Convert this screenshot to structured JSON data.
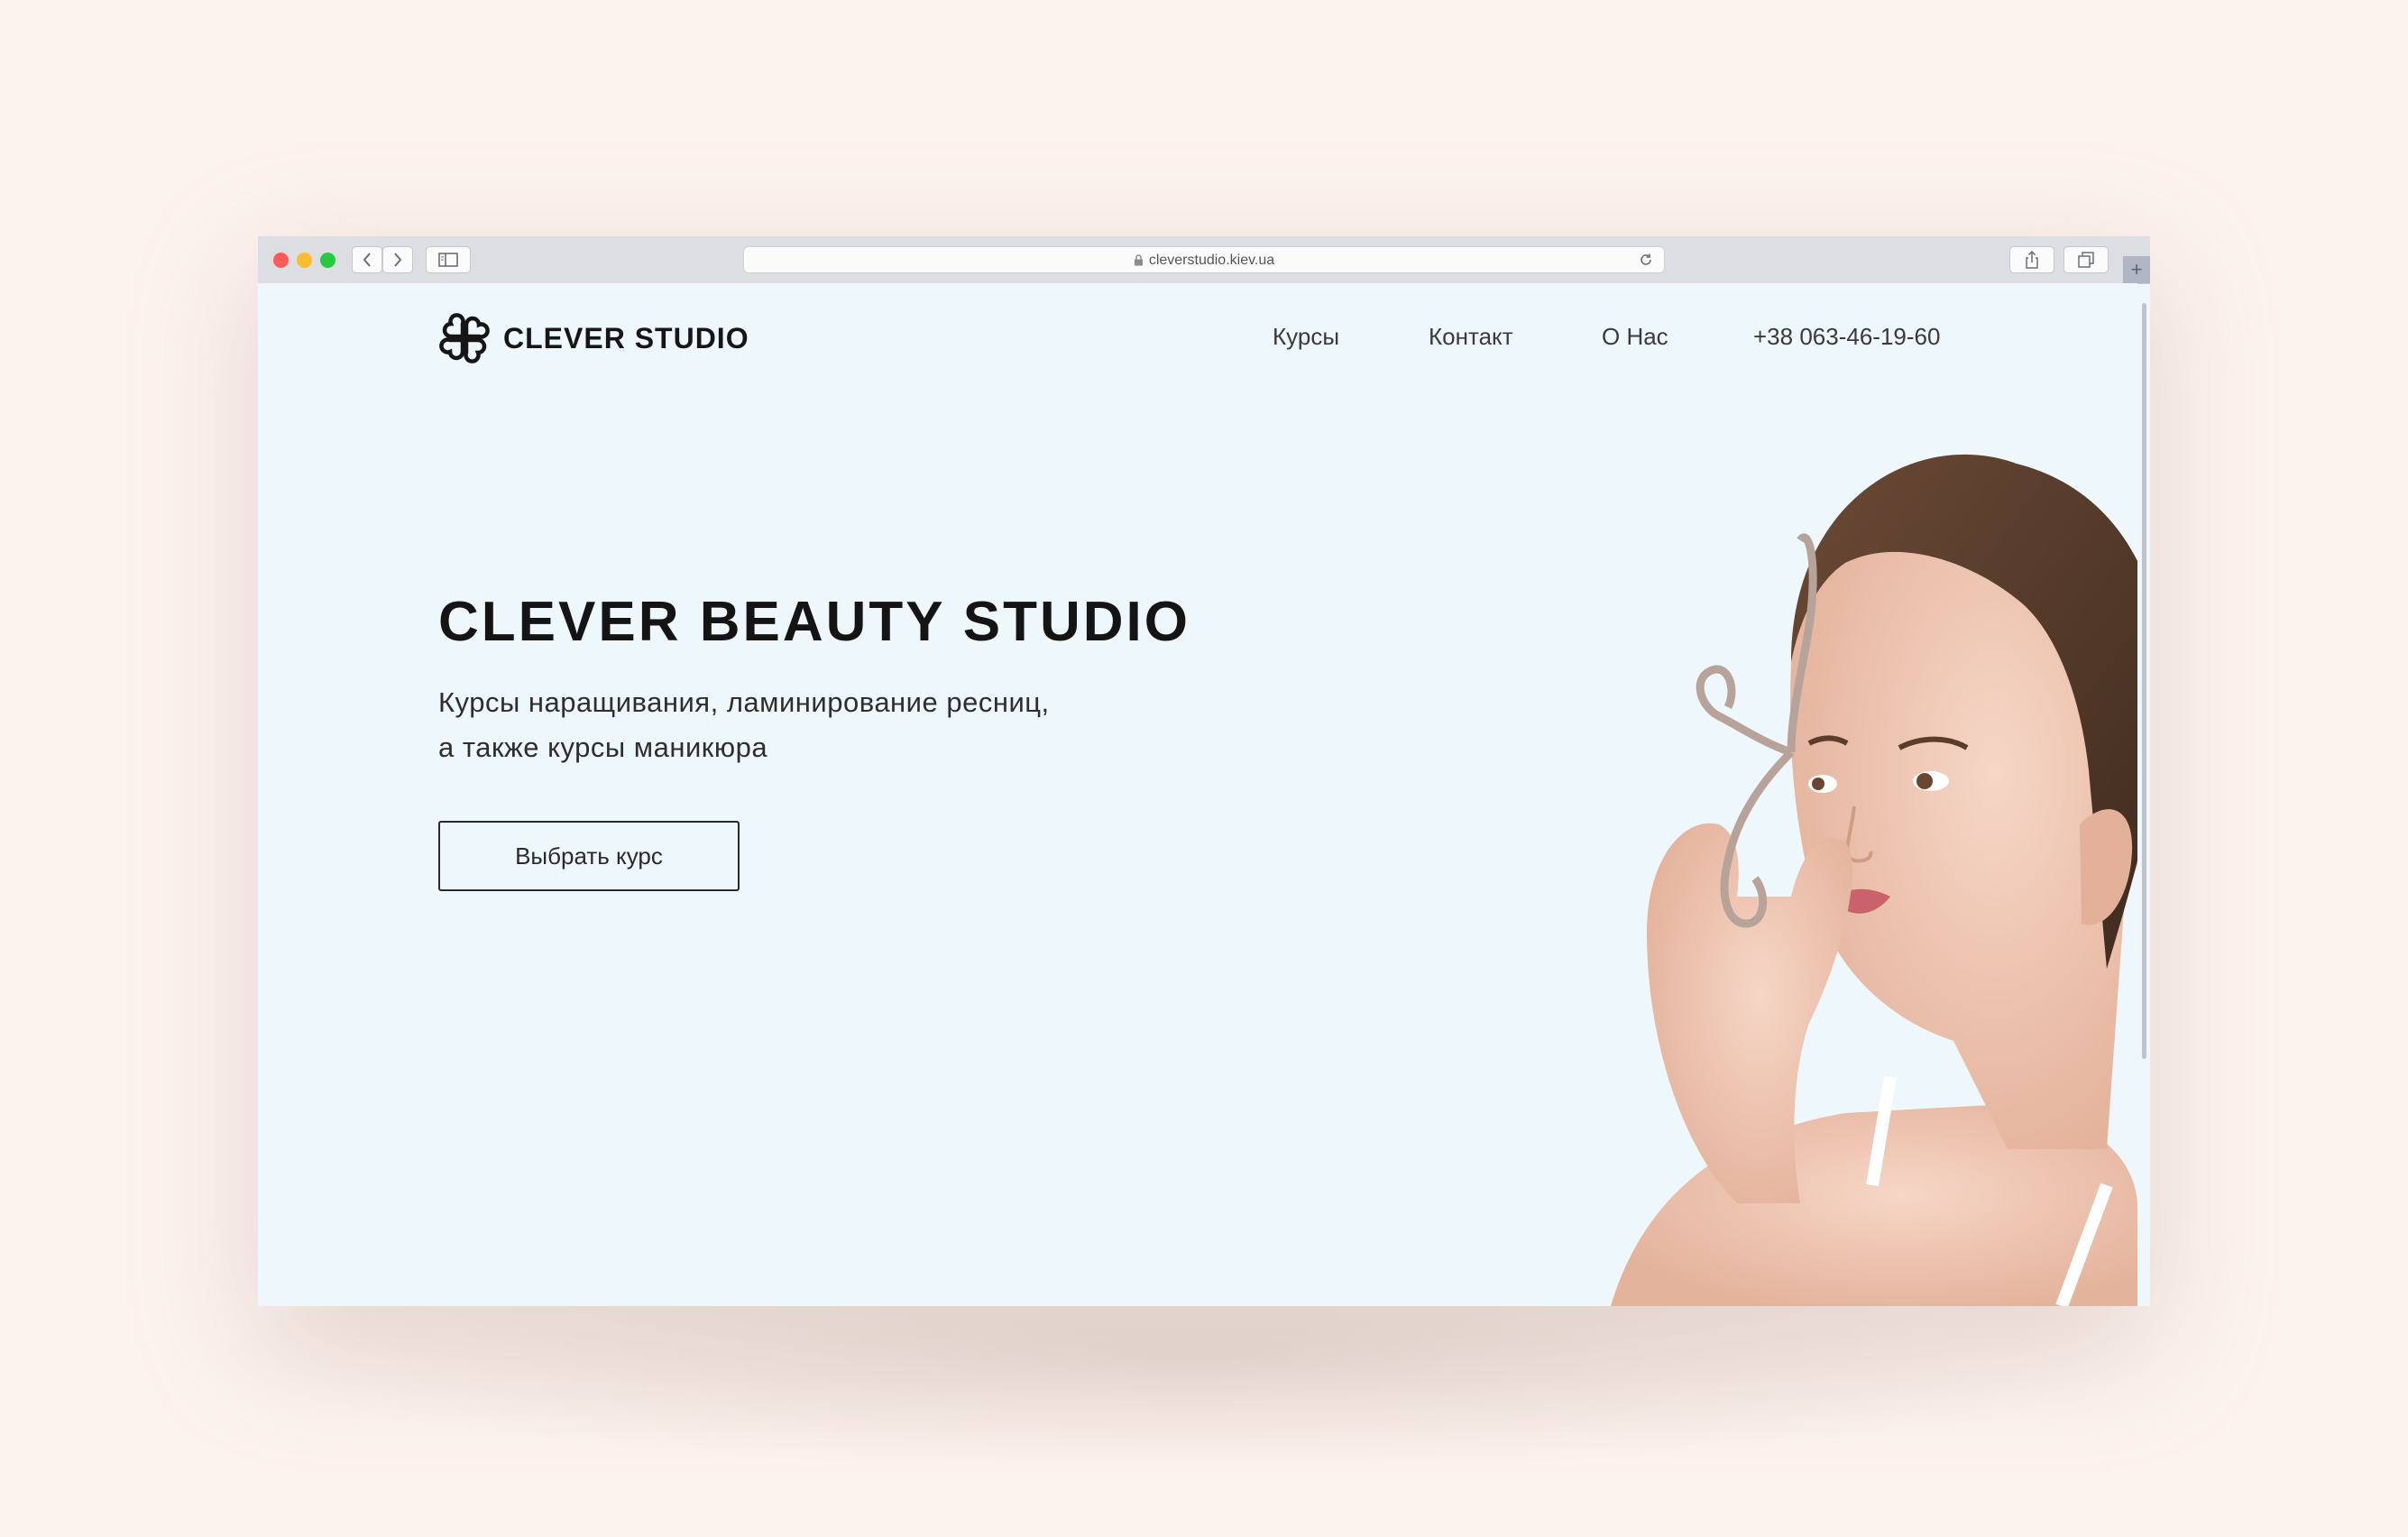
{
  "browser": {
    "url": "cleverstudio.kiev.ua",
    "new_tab": "+"
  },
  "site": {
    "logo_text": "CLEVER STUDIO",
    "nav": [
      {
        "label": "Курсы"
      },
      {
        "label": "Контакт"
      },
      {
        "label": "О Нас"
      },
      {
        "label": "+38 063-46-19-60"
      }
    ],
    "hero": {
      "title": "CLEVER BEAUTY STUDIO",
      "subtitle_line1": "Курсы наращивания, ламинирование ресниц,",
      "subtitle_line2": "а также курсы маникюра",
      "cta_label": "Выбрать курс"
    }
  },
  "colors": {
    "backdrop": "#fcf2ee",
    "page_bg": "#eef8fc",
    "text": "#161616"
  }
}
